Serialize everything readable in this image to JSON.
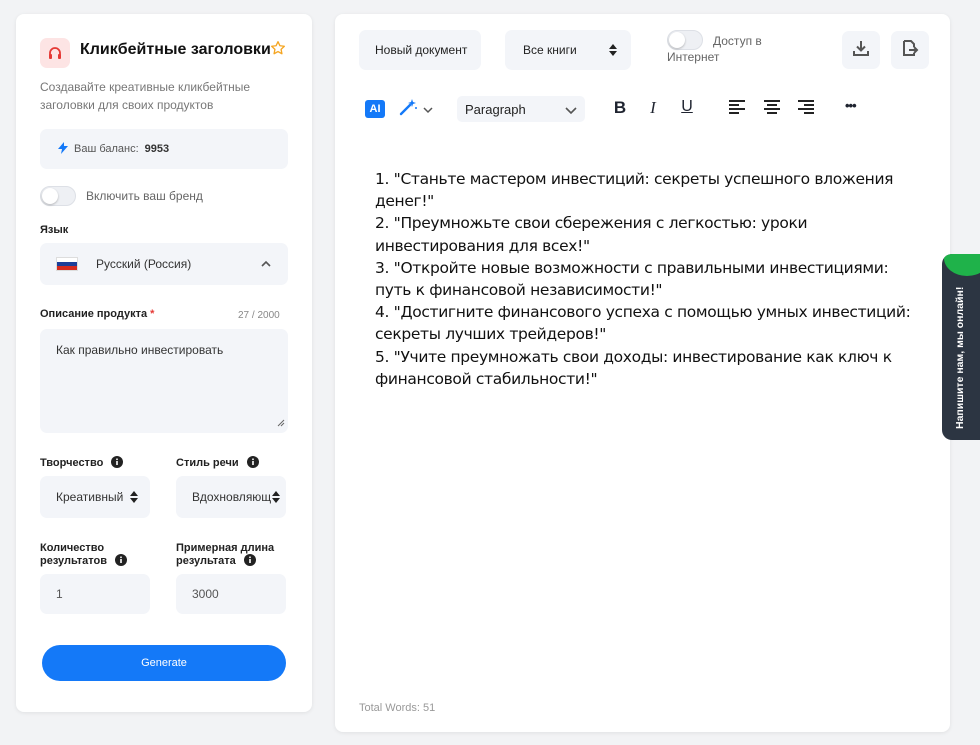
{
  "left": {
    "title": "Кликбейтные заголовки",
    "subtitle": "Создавайте креативные кликбейтные заголовки для своих продуктов",
    "balance_label": "Ваш баланс:",
    "balance_value": "9953",
    "brand_label": "Включить ваш бренд",
    "language_label": "Язык",
    "language_value": "Русский (Россия)",
    "description_label": "Описание продукта",
    "description_required": "*",
    "description_counter": "27 / 2000",
    "description_value": "Как правильно инвестировать",
    "creativity_label": "Творчество",
    "creativity_value": "Креативный",
    "tone_label": "Стиль речи",
    "tone_value": "Вдохновляющ",
    "results_label_1": "Количество",
    "results_label_2": "результатов",
    "results_value": "1",
    "length_label_1": "Примерная длина",
    "length_label_2": "результата",
    "length_value": "3000",
    "generate_label": "Generate"
  },
  "toolbar": {
    "new_doc": "Новый документ",
    "books": "Все книги",
    "web_access": "Доступ в Интернет",
    "ai_badge": "AI",
    "paragraph": "Paragraph",
    "bold": "B",
    "italic": "I",
    "underline": "U",
    "more": "•••"
  },
  "editor": {
    "lines": [
      "1. \"Станьте мастером инвестиций: секреты успешного вложения денег!\"",
      "2. \"Преумножьте свои сбережения с легкостью: уроки инвестирования для всех!\"",
      "3. \"Откройте новые возможности с правильными инвестициями: путь к финансовой независимости!\"",
      "4. \"Достигните финансового успеха с помощью умных инвестиций: секреты лучших трейдеров!\"",
      "5. \"Учите преумножать свои доходы: инвестирование как ключ к финансовой стабильности!\""
    ],
    "word_count": "Total Words: 51"
  },
  "chat": {
    "label": "Напишите нам, мы онлайн!"
  },
  "colors": {
    "accent": "#1479f8",
    "chat_bg": "#2c3542",
    "chat_green": "#1fb24a",
    "required": "#e53935"
  }
}
